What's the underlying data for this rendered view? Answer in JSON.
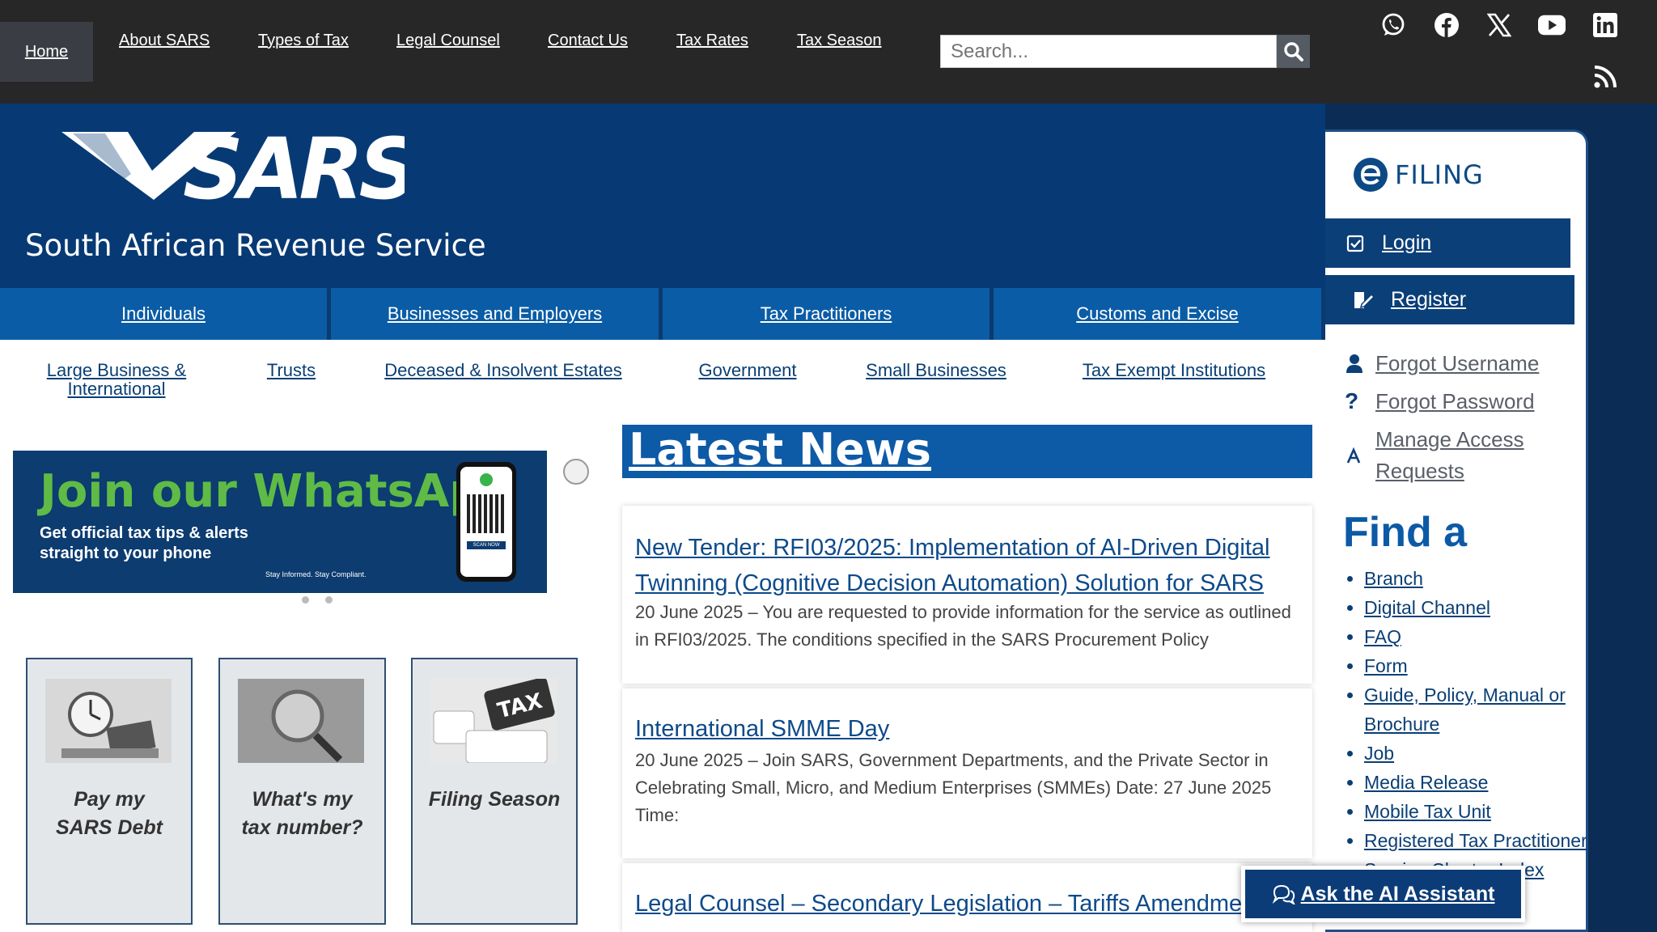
{
  "topnav": {
    "items": [
      "Home",
      "About SARS",
      "Types of Tax",
      "Legal Counsel",
      "Contact Us",
      "Tax Rates",
      "Tax Season"
    ],
    "search_placeholder": "Search..."
  },
  "social_icons": [
    "whatsapp-icon",
    "facebook-icon",
    "x-icon",
    "youtube-icon",
    "linkedin-icon",
    "rss-icon"
  ],
  "header": {
    "logo_text": "SARS",
    "subtitle": "South African Revenue Service"
  },
  "categories": [
    "Individuals",
    "Businesses and Employers",
    "Tax Practitioners",
    "Customs and Excise"
  ],
  "subcategories": [
    "Large Business & International",
    "Trusts",
    "Deceased & Insolvent Estates",
    "Government",
    "Small Businesses",
    "Tax Exempt Institutions"
  ],
  "banner": {
    "title": "Join our WhatsApp",
    "text": "Get official tax tips & alerts straight to your phone",
    "tagline": "Stay Informed. Stay Compliant.",
    "phone_label": "SCAN NOW"
  },
  "cards": [
    {
      "label1": "Pay my",
      "label2": "SARS Debt"
    },
    {
      "label1": "What's my",
      "label2": "tax number?"
    },
    {
      "label1": "Filing Season",
      "label2": ""
    }
  ],
  "news": {
    "title": "Latest News",
    "items": [
      {
        "headline": "New Tender: RFI03/2025: Implementation of AI-Driven Digital Twinning (Cognitive Decision Automation) Solution for SARS",
        "body": "20 June 2025 – You are requested to provide information for the service as outlined in RFI03/2025. The conditions specified in the SARS Procurement Policy"
      },
      {
        "headline": "International SMME Day",
        "body": "20 June 2025 – Join SARS, Government Departments, and the Private Sector in Celebrating Small, Micro, and Medium Enterprises (SMMEs) Date: 27 June 2025 Time:"
      },
      {
        "headline": "Legal Counsel – Secondary Legislation – Tariffs Amendments 2025",
        "body": ""
      }
    ]
  },
  "sidebar": {
    "efiling_label": "FILING",
    "login": "Login",
    "register": "Register",
    "links": [
      "Forgot Username",
      "Forgot Password",
      "Manage Access Requests"
    ],
    "find_title": "Find a",
    "find_items": [
      "Branch",
      "Digital Channel",
      "FAQ",
      "Form",
      "Guide, Policy, Manual or Brochure",
      "Job",
      "Media Release",
      "Mobile Tax Unit",
      "Registered Tax Practitioner",
      "Service Charter Index"
    ]
  },
  "ai_assistant": "Ask the AI Assistant"
}
